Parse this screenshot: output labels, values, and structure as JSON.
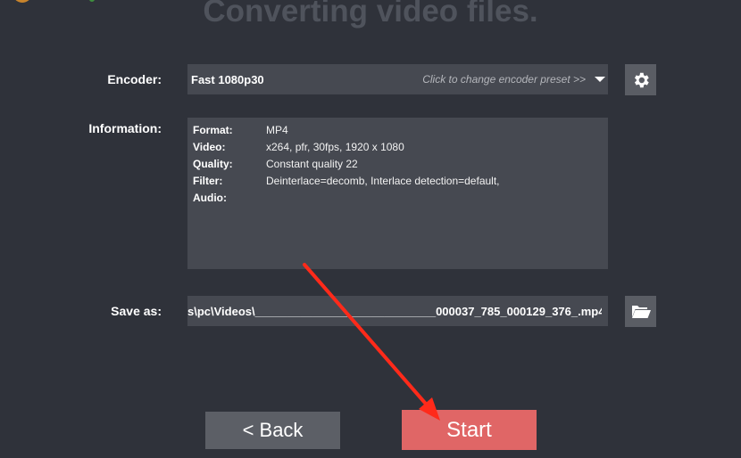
{
  "header": {
    "title": "Converting video files."
  },
  "encoder": {
    "label": "Encoder:",
    "value": "Fast 1080p30",
    "hint": "Click to change encoder preset >>",
    "settings_icon": "gear-icon"
  },
  "information": {
    "label": "Information:",
    "rows": [
      {
        "key": "Format:",
        "value": "MP4"
      },
      {
        "key": "Video:",
        "value": "x264, pfr, 30fps, 1920 x 1080"
      },
      {
        "key": "Quality:",
        "value": "Constant quality 22"
      },
      {
        "key": "Filter:",
        "value": "Deinterlace=decomb, Interlace detection=default,"
      },
      {
        "key": "Audio:",
        "value": ""
      }
    ]
  },
  "save_as": {
    "label": "Save as:",
    "value": "s\\pc\\Videos\\____________________________000037_785_000129_376_.mp4",
    "browse_icon": "folder-open-icon"
  },
  "buttons": {
    "back_label": "<  Back",
    "start_label": "Start"
  },
  "colors": {
    "background": "#2f323a",
    "field": "#464951",
    "start_button": "#e06666",
    "annotation_arrow": "#ff2a1a"
  }
}
